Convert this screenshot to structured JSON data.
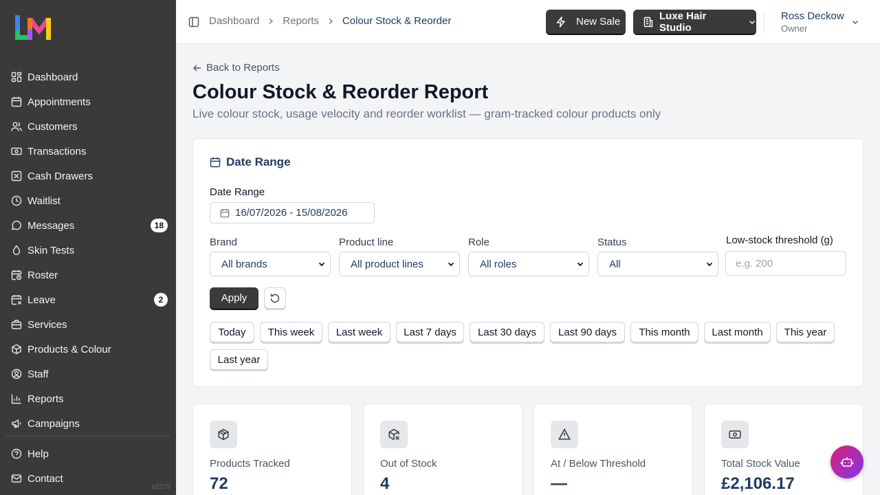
{
  "sidebar": {
    "items": [
      {
        "label": "Dashboard",
        "icon": "dashboard-icon"
      },
      {
        "label": "Appointments",
        "icon": "calendar-icon"
      },
      {
        "label": "Customers",
        "icon": "users-icon"
      },
      {
        "label": "Transactions",
        "icon": "banknote-icon"
      },
      {
        "label": "Cash Drawers",
        "icon": "cash-drawer-icon"
      },
      {
        "label": "Waitlist",
        "icon": "clock-icon"
      },
      {
        "label": "Messages",
        "icon": "message-icon",
        "badge": "18"
      },
      {
        "label": "Skin Tests",
        "icon": "droplet-icon"
      },
      {
        "label": "Roster",
        "icon": "calendar-clock-icon"
      },
      {
        "label": "Leave",
        "icon": "calendar-x-icon",
        "badge": "2"
      },
      {
        "label": "Services",
        "icon": "briefcase-icon"
      },
      {
        "label": "Products & Colour",
        "icon": "package-icon"
      },
      {
        "label": "Staff",
        "icon": "user-circle-icon"
      },
      {
        "label": "Reports",
        "icon": "bar-chart-icon"
      },
      {
        "label": "Campaigns",
        "icon": "megaphone-icon"
      }
    ],
    "bottom_items": [
      {
        "label": "Help",
        "icon": "help-icon"
      },
      {
        "label": "Contact",
        "icon": "mail-icon"
      }
    ],
    "version": "v2279"
  },
  "topbar": {
    "breadcrumbs": [
      "Dashboard",
      "Reports",
      "Colour Stock & Reorder"
    ],
    "new_sale_label": "New Sale",
    "studio_label": "Luxe Hair Studio",
    "user_name": "Ross Deckow",
    "user_role": "Owner"
  },
  "page": {
    "back_label": "Back to Reports",
    "title": "Colour Stock & Reorder Report",
    "subtitle": "Live colour stock, usage velocity and reorder worklist — gram-tracked colour products only"
  },
  "filters": {
    "card_title": "Date Range",
    "date_range_label": "Date Range",
    "date_range_value": "16/07/2026 - 15/08/2026",
    "brand_label": "Brand",
    "brand_value": "All brands",
    "product_line_label": "Product line",
    "product_line_value": "All product lines",
    "role_label": "Role",
    "role_value": "All roles",
    "status_label": "Status",
    "status_value": "All",
    "threshold_label": "Low-stock threshold (g)",
    "threshold_placeholder": "e.g. 200",
    "apply_label": "Apply",
    "presets": [
      "Today",
      "This week",
      "Last week",
      "Last 7 days",
      "Last 30 days",
      "Last 90 days",
      "This month",
      "Last month",
      "This year",
      "Last year"
    ]
  },
  "stats": [
    {
      "label": "Products Tracked",
      "value": "72",
      "icon": "box-icon"
    },
    {
      "label": "Out of Stock",
      "value": "4",
      "icon": "box-x-icon"
    },
    {
      "label": "At / Below Threshold",
      "value": "—",
      "icon": "warning-icon"
    },
    {
      "label": "Total Stock Value",
      "value": "£2,106.17",
      "icon": "banknote-icon"
    }
  ],
  "colors": {
    "sidebar_bg": "#3a3a3a",
    "accent_navy": "#1e3a5f",
    "fab_gradient_start": "#e11d74",
    "fab_gradient_end": "#7c3aed"
  }
}
